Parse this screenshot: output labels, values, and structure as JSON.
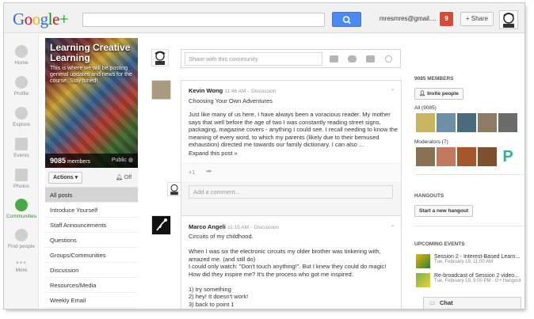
{
  "header": {
    "logo": {
      "google": "Google",
      "plus": "+"
    },
    "account_email": "mresmres@gmail....",
    "notification_count": "9",
    "share_label": "+ Share"
  },
  "leftnav": [
    {
      "label": "Home",
      "icon": "home-icon"
    },
    {
      "label": "Profile",
      "icon": "profile-icon"
    },
    {
      "label": "Explore",
      "icon": "explore-icon"
    },
    {
      "label": "Events",
      "icon": "events-icon"
    },
    {
      "label": "Photos",
      "icon": "photos-icon"
    },
    {
      "label": "Communities",
      "icon": "communities-icon",
      "active": true
    },
    {
      "label": "Find people",
      "icon": "find-people-icon"
    },
    {
      "label": "More",
      "icon": "more-icon"
    }
  ],
  "community": {
    "title": "Learning Creative Learning",
    "description": "This is where we will be posting general updates and news for the course. Stay tuned!",
    "member_count": "9085",
    "members_label": "members",
    "visibility": "Public",
    "actions_label": "Actions",
    "notifications_label": "Off",
    "categories": [
      "All posts",
      "Introduce Yourself",
      "Staff Announcements",
      "Questions",
      "Groups/Communities",
      "Discussion",
      "Resources/Media",
      "Weekly Email"
    ]
  },
  "stream": {
    "share_placeholder": "Share with this community",
    "comment_placeholder": "Add a comment...",
    "posts": [
      {
        "author": "Kevin Wong",
        "time": "11:46 AM",
        "category": "Discussion",
        "title": "Choosing Your Own Adventures",
        "body": "Just like many of us here, I have always been a voracious reader.  My mother says that well before the age of two I was constantly reading street signs, packaging, magazine covers - anything I could see.  I recall needing to know the meaning of every word, to which my parents (likely due to their bemused exhaustion) directed me towards our family dictionary.  I can also ...",
        "expand": "Expand this post »",
        "plus_one": "+1"
      },
      {
        "author": "Marco Angeli",
        "time": "11:15 AM",
        "category": "Discussion",
        "lines": [
          "Circuits of my childhood.",
          "",
          "When I was six the electronic circuits my older brother was tinkering with, amazed me. (and still do)",
          "I could only watch: \"Don't touch anything!\". But I knew they could do magic!",
          "How did they inspire me? It's the process who got me inspired:",
          "",
          "1) try something",
          "2) hey! It doesn't work!",
          "3) back to point 1"
        ]
      }
    ]
  },
  "sidebar": {
    "members_heading": "9085 MEMBERS",
    "invite_label": "Invite people",
    "all_label": "All (9085)",
    "moderators_label": "Moderators (7)",
    "hangouts_heading": "HANGOUTS",
    "hangout_button": "Start a new hangout",
    "events_heading": "UPCOMING EVENTS",
    "events": [
      {
        "title": "Session 2 - Interest-Based Learn...",
        "when": "Tue, February 19, 11:00 AM"
      },
      {
        "title": "Re-broadcast of Session 2 video...",
        "when": "Tue, February 19, 8:00 PM - G+ Hangout"
      }
    ],
    "chat_label": "Chat"
  },
  "colors": {
    "accent_blue": "#4a8af4",
    "notification_red": "#db4a37",
    "communities_green": "#4caa46"
  }
}
